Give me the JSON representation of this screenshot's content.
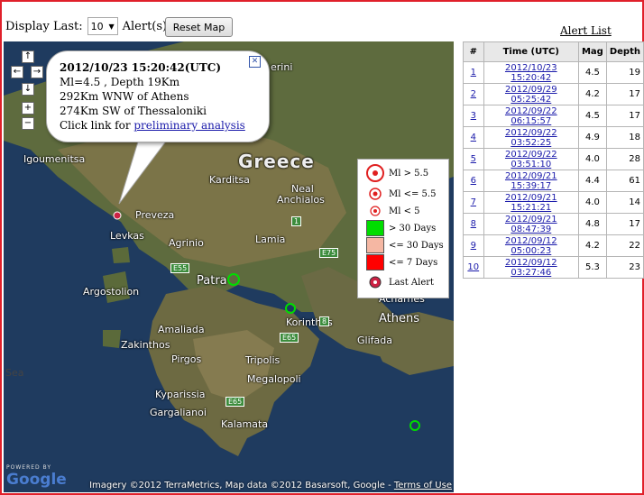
{
  "controls": {
    "display_last_label": "Display Last:",
    "count_value": "10",
    "alerts_label": "Alert(s)",
    "reset_label": "Reset Map"
  },
  "map": {
    "places": [
      "Igoumenitsa",
      "Greece",
      "Karditsa",
      "Preveza",
      "Neal",
      "Anchialos",
      "Levkas",
      "Lamia",
      "Agrinio",
      "Patra",
      "Argostolion",
      "Korinthos",
      "Athens",
      "Glifada",
      "Amaliada",
      "Zakinthos",
      "Pirgos",
      "Tripolis",
      "Megalopoli",
      "Kyparissia",
      "Gargalianoi",
      "Kalamata",
      "Sea",
      "Acharnes",
      "erini"
    ],
    "roads": [
      "E55",
      "E75",
      "E65",
      "E65",
      "1",
      "8"
    ],
    "powered_by": "POWERED BY",
    "google": "Google",
    "copyright": "Imagery ©2012 TerraMetrics, Map data ©2012 Basarsoft, Google - ",
    "terms": "Terms of Use"
  },
  "balloon": {
    "title": "2012/10/23 15:20:42(UTC)",
    "line1": "Ml=4.5 , Depth 19Km",
    "line2": "292Km WNW of Athens",
    "line3": "274Km SW of Thessaloniki",
    "link_prefix": "Click link for ",
    "link_text": "preliminary analysis"
  },
  "legend": {
    "items": [
      "Ml > 5.5",
      "Ml <= 5.5",
      "Ml < 5",
      "> 30 Days",
      "<= 30 Days",
      "<= 7 Days",
      "Last Alert"
    ],
    "colors": {
      "older": "#00dd00",
      "month": "#f5b7a3",
      "week": "#ff0000",
      "marker": "#cc2244"
    }
  },
  "alerts": {
    "title": "Alert List",
    "headers": [
      "#",
      "Time (UTC)",
      "Mag",
      "Depth"
    ],
    "rows": [
      {
        "n": "1",
        "time": "2012/10/23 15:20:42",
        "mag": "4.5",
        "depth": "19"
      },
      {
        "n": "2",
        "time": "2012/09/29 05:25:42",
        "mag": "4.2",
        "depth": "17"
      },
      {
        "n": "3",
        "time": "2012/09/22 06:15:57",
        "mag": "4.5",
        "depth": "17"
      },
      {
        "n": "4",
        "time": "2012/09/22 03:52:25",
        "mag": "4.9",
        "depth": "18"
      },
      {
        "n": "5",
        "time": "2012/09/22 03:51:10",
        "mag": "4.0",
        "depth": "28"
      },
      {
        "n": "6",
        "time": "2012/09/21 15:39:17",
        "mag": "4.4",
        "depth": "61"
      },
      {
        "n": "7",
        "time": "2012/09/21 15:21:21",
        "mag": "4.0",
        "depth": "14"
      },
      {
        "n": "8",
        "time": "2012/09/21 08:47:39",
        "mag": "4.8",
        "depth": "17"
      },
      {
        "n": "9",
        "time": "2012/09/12 05:00:23",
        "mag": "4.2",
        "depth": "22"
      },
      {
        "n": "10",
        "time": "2012/09/12 03:27:46",
        "mag": "5.3",
        "depth": "23"
      }
    ]
  }
}
